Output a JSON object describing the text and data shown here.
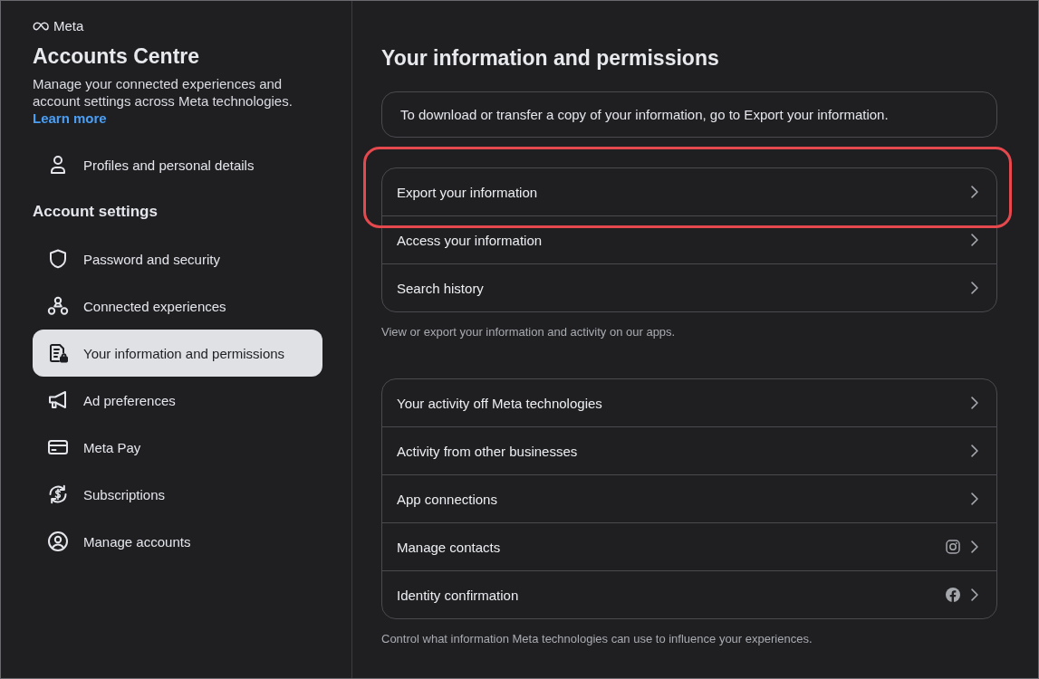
{
  "brand": {
    "name": "Meta"
  },
  "sidebar": {
    "title": "Accounts Centre",
    "description": "Manage your connected experiences and account settings across Meta technologies.",
    "link": "Learn more",
    "profile_items": [
      {
        "label": "Profiles and personal details",
        "selected": false
      }
    ],
    "section_title": "Account settings",
    "items": [
      {
        "label": "Password and security",
        "selected": false
      },
      {
        "label": "Connected experiences",
        "selected": false
      },
      {
        "label": "Your information and permissions",
        "selected": true
      },
      {
        "label": "Ad preferences",
        "selected": false
      },
      {
        "label": "Meta Pay",
        "selected": false
      },
      {
        "label": "Subscriptions",
        "selected": false
      },
      {
        "label": "Manage accounts",
        "selected": false
      }
    ]
  },
  "main": {
    "title": "Your information and permissions",
    "notice": "To download or transfer a copy of your information, go to Export your information.",
    "groups": [
      {
        "items": [
          {
            "label": "Export your information",
            "highlighted": true
          },
          {
            "label": "Access your information",
            "highlighted": false
          },
          {
            "label": "Search history",
            "highlighted": false
          }
        ],
        "caption": "View or export your information and activity on our apps."
      },
      {
        "items": [
          {
            "label": "Your activity off Meta technologies",
            "highlighted": false
          },
          {
            "label": "Activity from other businesses",
            "highlighted": false
          },
          {
            "label": "App connections",
            "highlighted": false
          },
          {
            "label": "Manage contacts",
            "highlighted": false
          },
          {
            "label": "Identity confirmation",
            "highlighted": false
          }
        ],
        "caption": "Control what information Meta technologies can use to influence your experiences."
      }
    ]
  }
}
